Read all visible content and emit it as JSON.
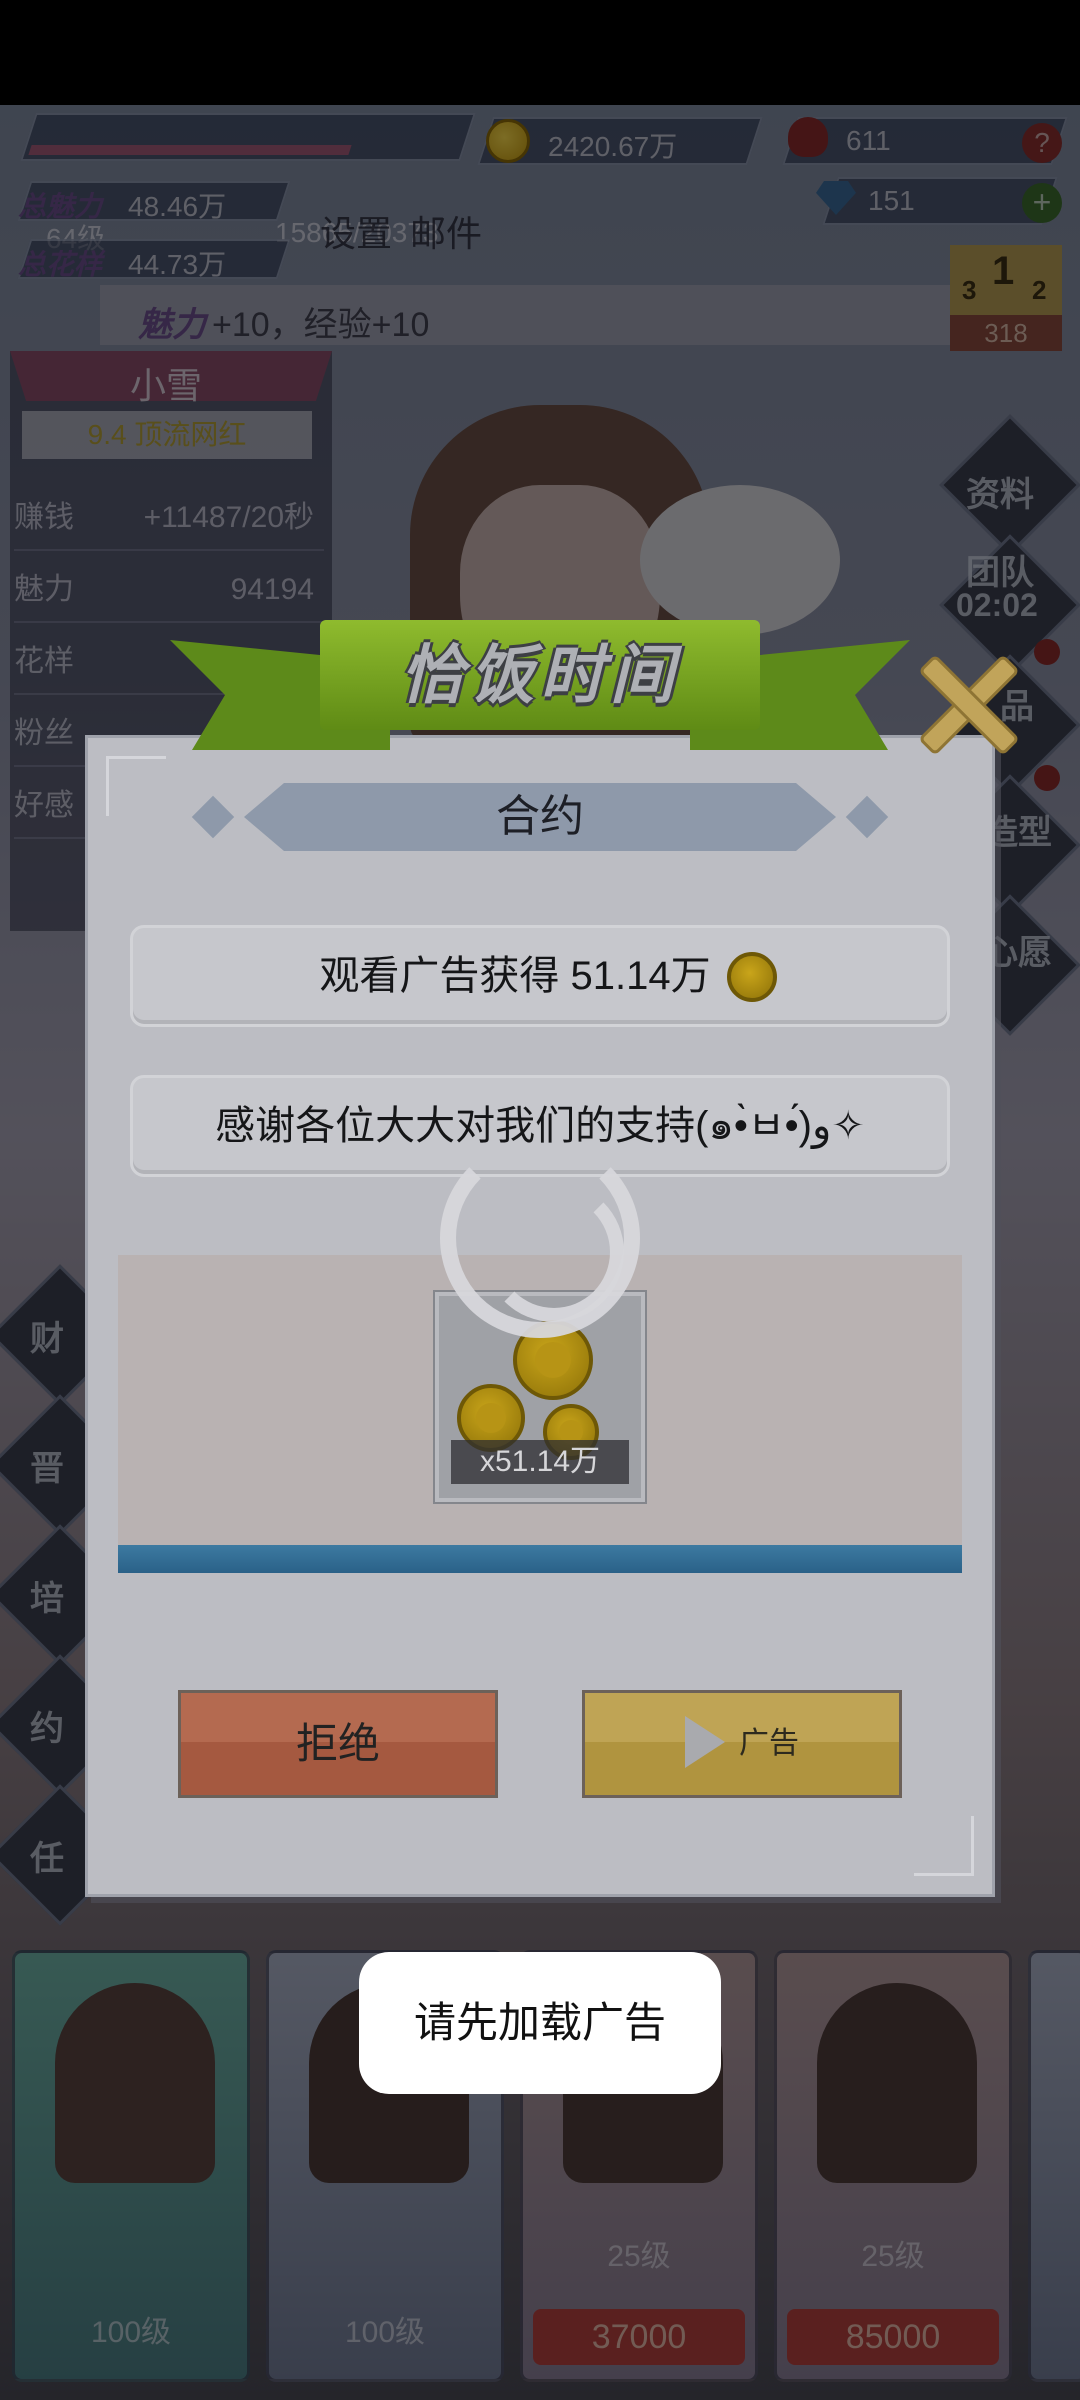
{
  "hud": {
    "level": "64级",
    "exp": "15865/20373",
    "gold": "2420.67万",
    "roses": "611",
    "diamonds": "151",
    "total_charm_label": "总魅力",
    "total_charm_value": "48.46万",
    "total_style_label": "总花样",
    "total_style_value": "44.73万",
    "settings_label": "设置",
    "mail_label": "邮件",
    "notice_label": "魅力",
    "notice_rest": "+10，经验+10",
    "rank_first": "1",
    "rank_second": "2",
    "rank_third": "3",
    "rank_value": "318"
  },
  "character_panel": {
    "name": "小雪",
    "title": "9.4 顶流网红",
    "stats": [
      {
        "label": "赚钱",
        "value": "+11487/20秒"
      },
      {
        "label": "魅力",
        "value": "94194"
      },
      {
        "label": "花样",
        "value": ""
      },
      {
        "label": "粉丝",
        "value": ""
      },
      {
        "label": "好感",
        "value": ""
      }
    ]
  },
  "side_menu_right": {
    "profile": "资料",
    "team": "团队",
    "team_timer": "02:02",
    "gifts": "品",
    "styles": "造型",
    "wish": "心愿"
  },
  "side_menu_left": [
    "财",
    "晋",
    "培",
    "约",
    "任"
  ],
  "girl_cards": [
    {
      "level": "100级",
      "price": ""
    },
    {
      "level": "100级",
      "price": ""
    },
    {
      "level": "25级",
      "price": "37000"
    },
    {
      "level": "25级",
      "price": "85000"
    }
  ],
  "dialog": {
    "banner_title": "恰饭时间",
    "section_title": "合约",
    "message_reward": "观看广告获得 51.14万",
    "message_thanks": "感谢各位大大对我们的支持(๑•̀ㅂ•́)و✧",
    "reward_quantity": "x51.14万",
    "reject_label": "拒绝",
    "ad_label": "广告"
  },
  "toast": {
    "text": "请先加载广告"
  },
  "colors": {
    "banner_green": "#8fbb2e",
    "reject_red": "#b46a50",
    "ad_yellow": "#bfa455",
    "reward_bar_blue": "#3d7aa1"
  }
}
